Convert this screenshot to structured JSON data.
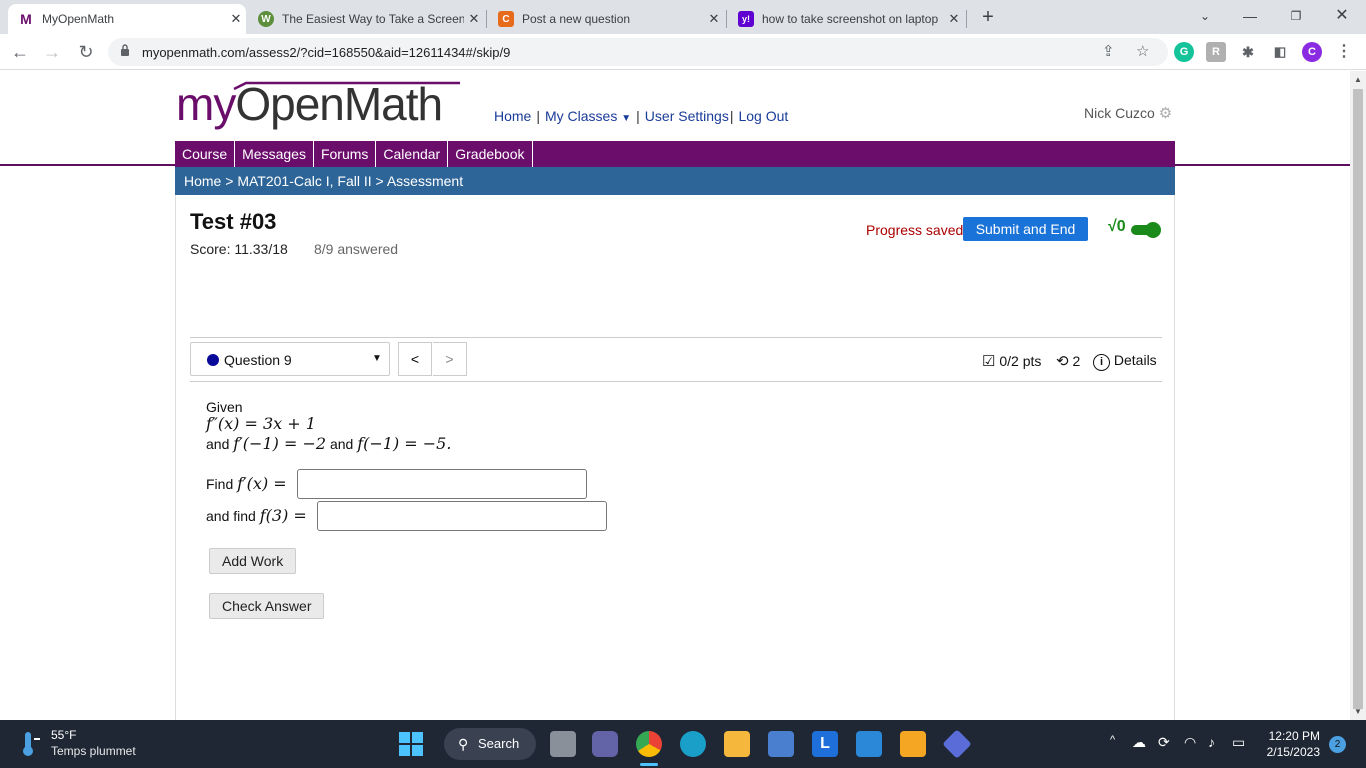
{
  "browser": {
    "tabs": [
      {
        "title": "MyOpenMath",
        "fav": "M",
        "fav_color": "#6b0d6b",
        "active": true
      },
      {
        "title": "The Easiest Way to Take a Screen",
        "fav": "W",
        "fav_color": "#5e8f3d",
        "active": false
      },
      {
        "title": "Post a new question",
        "fav": "C",
        "fav_color": "#e66b1a",
        "active": false
      },
      {
        "title": "how to take screenshot on laptop",
        "fav": "y!",
        "fav_color": "#5f01d1",
        "active": false
      }
    ],
    "url": "myopenmath.com/assess2/?cid=168550&aid=12611434#/skip/9",
    "profile_initial": "C"
  },
  "site": {
    "logo_my": "my",
    "logo_rest": "OpenMath",
    "topnav": {
      "home": "Home",
      "classes": "My Classes",
      "settings": "User Settings",
      "logout": "Log Out"
    },
    "user_name": "Nick Cuzco",
    "mainnav": [
      "Course",
      "Messages",
      "Forums",
      "Calendar",
      "Gradebook"
    ],
    "breadcrumb": {
      "home": "Home",
      "course": "MAT201-Calc I, Fall II",
      "current": "Assessment"
    }
  },
  "assessment": {
    "title": "Test #03",
    "score": "Score: 11.33/18",
    "answered": "8/9 answered",
    "progress_status": "Progress saved",
    "submit_label": "Submit and End",
    "question_label": "Question 9",
    "points": "0/2 pts",
    "attempts": "2",
    "details": "Details"
  },
  "question": {
    "given": "Given",
    "eq1": "f″(x) = 3x + 1",
    "and_word": "and",
    "eq2": "f′(−1) = −2",
    "and_word2": "and",
    "eq3": "f(−1) = −5.",
    "find1_prefix": "Find",
    "find1_expr": "f′(x) =",
    "find2_prefix": "and find",
    "find2_expr": "f(3) =",
    "answer1": "",
    "answer2": "",
    "add_work": "Add Work",
    "check_answer": "Check Answer"
  },
  "taskbar": {
    "temp": "55°F",
    "weather": "Temps plummet",
    "search": "Search",
    "time": "12:20 PM",
    "date": "2/15/2023",
    "notifications": "2"
  },
  "colors": {
    "brand_purple": "#6b0d6b",
    "breadcrumb_blue": "#2e6598",
    "submit_blue": "#1a73d8",
    "progress_red": "#aa0000",
    "toggle_green": "#1a8a1a"
  }
}
